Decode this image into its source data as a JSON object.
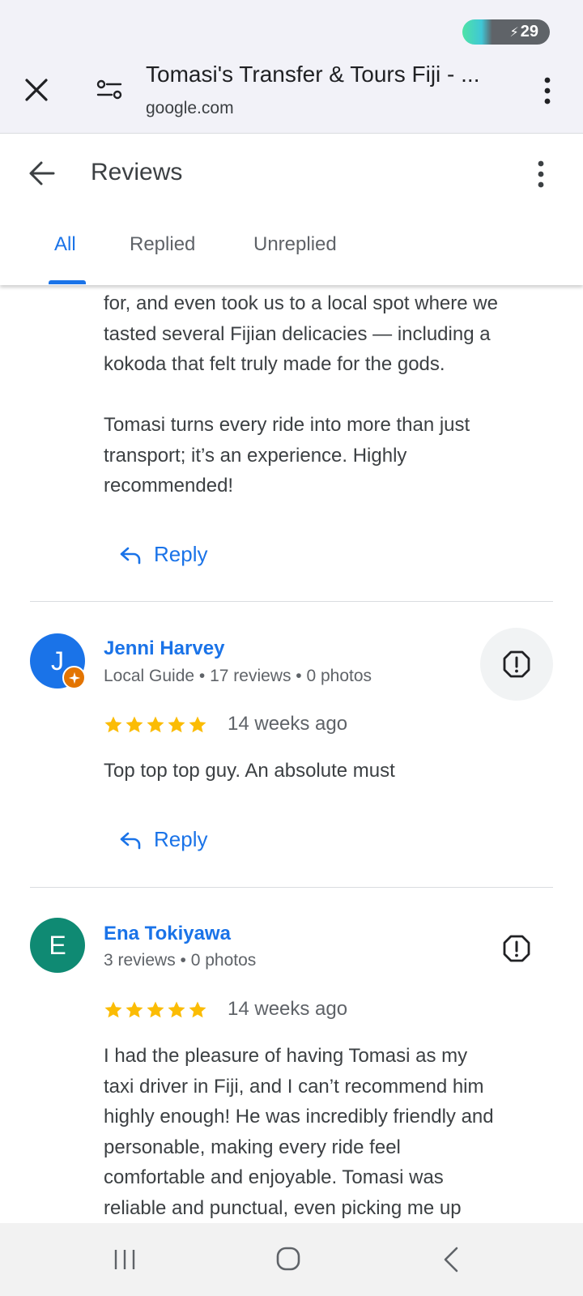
{
  "status_bar": {
    "battery_level": "29"
  },
  "browser": {
    "page_title": "Tomasi's Transfer & Tours Fiji - ...",
    "domain": "google.com"
  },
  "header": {
    "title": "Reviews"
  },
  "tabs": [
    {
      "label": "All",
      "active": true
    },
    {
      "label": "Replied",
      "active": false
    },
    {
      "label": "Unreplied",
      "active": false
    }
  ],
  "reviews": [
    {
      "text_lines": [
        "for, and even took us to a local spot where we",
        "tasted several Fijian delicacies — including a",
        "kokoda that felt truly made for the gods.",
        "",
        "Tomasi turns every ride into more than just",
        "transport; it’s an experience. Highly",
        "recommended!"
      ],
      "reply_label": "Reply"
    },
    {
      "avatar_letter": "J",
      "avatar_color": "#1a73e8",
      "name": "Jenni Harvey",
      "meta": "Local Guide • 17 reviews • 0 photos",
      "rating": 5,
      "time_ago": "14 weeks ago",
      "text": "Top top top guy. An absolute must",
      "reply_label": "Reply"
    },
    {
      "avatar_letter": "E",
      "avatar_color": "#0f8a73",
      "name": "Ena Tokiyawa",
      "meta": "3 reviews • 0 photos",
      "rating": 5,
      "time_ago": "14 weeks ago",
      "text_lines": [
        "I had the pleasure of having Tomasi as my",
        "taxi driver in Fiji, and I can’t recommend him",
        "highly enough! He was incredibly friendly and",
        "personable, making every ride feel",
        "comfortable and enjoyable. Tomasi was",
        "reliable and punctual, even picking me up"
      ]
    }
  ],
  "colors": {
    "accent": "#1a73e8",
    "star": "#fbbc04",
    "guide_badge": "#e37400"
  }
}
